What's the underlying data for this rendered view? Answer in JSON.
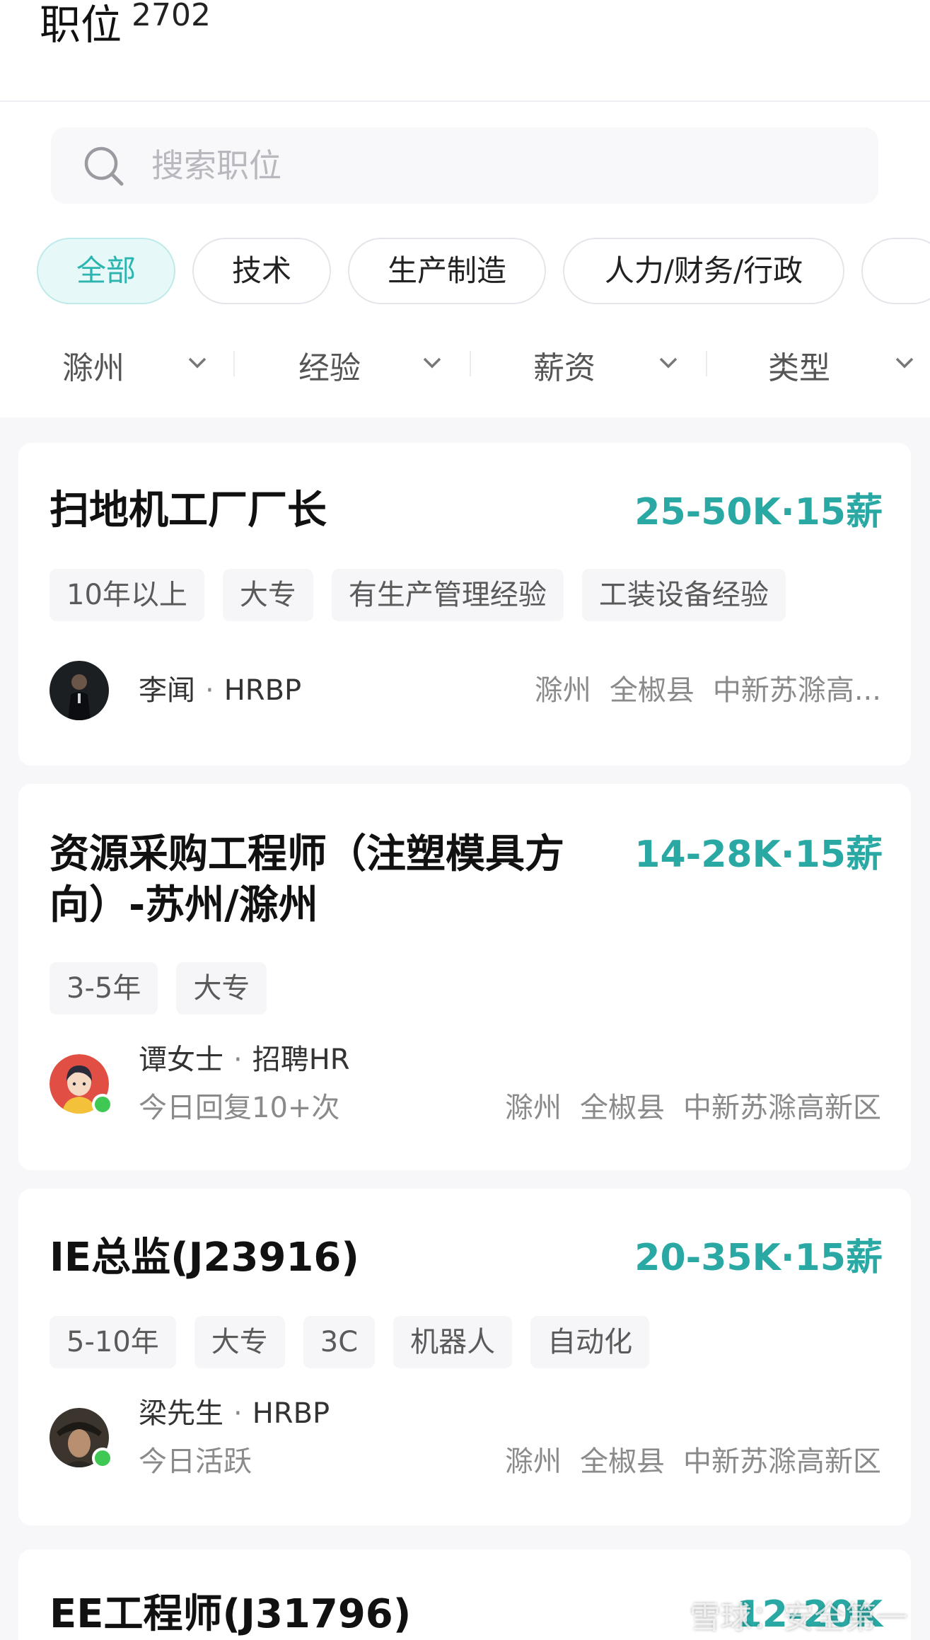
{
  "header": {
    "title": "职位",
    "count": "2702"
  },
  "search": {
    "placeholder": "搜索职位"
  },
  "categories": [
    {
      "label": "全部",
      "active": true
    },
    {
      "label": "技术",
      "active": false
    },
    {
      "label": "生产制造",
      "active": false
    },
    {
      "label": "人力/财务/行政",
      "active": false
    }
  ],
  "filters": [
    {
      "label": "滁州"
    },
    {
      "label": "经验"
    },
    {
      "label": "薪资"
    },
    {
      "label": "类型"
    }
  ],
  "jobs": [
    {
      "title": "扫地机工厂厂长",
      "salary": "25-50K·15薪",
      "tags": [
        "10年以上",
        "大专",
        "有生产管理经验",
        "工装设备经验"
      ],
      "recruiter_name": "李闻",
      "recruiter_role": "HRBP",
      "activity": "",
      "location": [
        "滁州",
        "全椒县",
        "中新苏滁高..."
      ],
      "online": false
    },
    {
      "title_line1": "资源采购工程师（注塑模具方",
      "title_line2": "向）-苏州/滁州",
      "salary": "14-28K·15薪",
      "tags": [
        "3-5年",
        "大专"
      ],
      "recruiter_name": "谭女士",
      "recruiter_role": "招聘HR",
      "activity": "今日回复10+次",
      "location": [
        "滁州",
        "全椒县",
        "中新苏滁高新区"
      ],
      "online": true
    },
    {
      "title": "IE总监(J23916)",
      "salary": "20-35K·15薪",
      "tags": [
        "5-10年",
        "大专",
        "3C",
        "机器人",
        "自动化"
      ],
      "recruiter_name": "梁先生",
      "recruiter_role": "HRBP",
      "activity": "今日活跃",
      "location": [
        "滁州",
        "全椒县",
        "中新苏滁高新区"
      ],
      "online": true
    },
    {
      "title": "EE工程师(J31796)",
      "salary": "12-20K"
    }
  ],
  "watermark": "雪球：安全第一",
  "colors": {
    "accent": "#2aa9a4",
    "chip_active_bg": "#e7f8f8",
    "online": "#3fc954"
  }
}
